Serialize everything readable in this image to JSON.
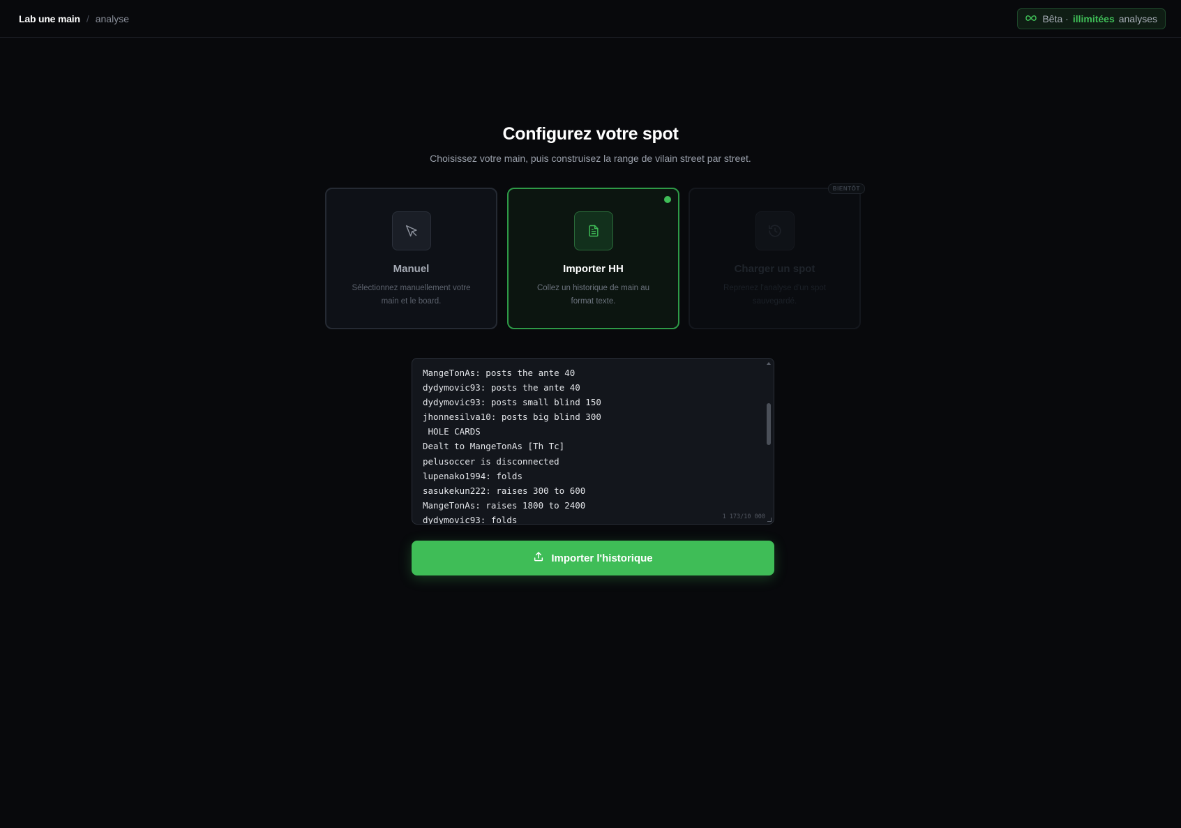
{
  "header": {
    "app_name": "Lab une main",
    "separator": "/",
    "page_name": "analyse",
    "beta": {
      "prefix": "Bêta ·",
      "highlight": "illimitées",
      "suffix": "analyses"
    }
  },
  "main": {
    "title": "Configurez votre spot",
    "subtitle": "Choisissez votre main, puis construisez la range de vilain street par street."
  },
  "modes": [
    {
      "id": "manuel",
      "title": "Manuel",
      "description": "Sélectionnez manuellement votre main et le board.",
      "icon": "cursor-icon",
      "state": "default"
    },
    {
      "id": "import",
      "title": "Importer HH",
      "description": "Collez un historique de main au format texte.",
      "icon": "document-icon",
      "state": "selected"
    },
    {
      "id": "spot",
      "title": "Charger un spot",
      "description": "Reprenez l'analyse d'un spot sauvegardé.",
      "icon": "history-icon",
      "state": "disabled",
      "badge": "BIENTÔT"
    }
  ],
  "hand_history": {
    "lines": [
      "MangeTonAs: posts the ante 40",
      "dydymovic93: posts the ante 40",
      "dydymovic93: posts small blind 150",
      "jhonnesilva10: posts big blind 300",
      " HOLE CARDS",
      "Dealt to MangeTonAs [Th Tc]",
      "pelusoccer is disconnected",
      "lupenako1994: folds",
      "sasukekun222: raises 300 to 600",
      "MangeTonAs: raises 1800 to 2400",
      "dydymovic93: folds"
    ],
    "char_count": "1 173/10 000"
  },
  "import_button": {
    "label": "Importer l'historique"
  },
  "colors": {
    "accent": "#3fbd57",
    "background": "#08090c"
  }
}
